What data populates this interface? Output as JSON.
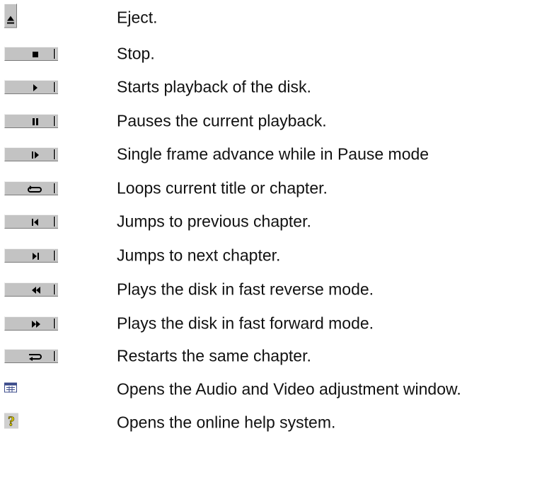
{
  "items": [
    {
      "icon": "eject-icon",
      "label": "Eject."
    },
    {
      "icon": "stop-icon",
      "label": "Stop."
    },
    {
      "icon": "play-icon",
      "label": "Starts playback of the disk."
    },
    {
      "icon": "pause-icon",
      "label": "Pauses the current playback."
    },
    {
      "icon": "step-frame-icon",
      "label": "Single frame advance while in Pause mode"
    },
    {
      "icon": "loop-icon",
      "label": "Loops current title or chapter."
    },
    {
      "icon": "previous-chapter-icon",
      "label": "Jumps to previous chapter."
    },
    {
      "icon": "next-chapter-icon",
      "label": "Jumps to next chapter."
    },
    {
      "icon": "fast-reverse-icon",
      "label": "Plays the disk in fast reverse mode."
    },
    {
      "icon": "fast-forward-icon",
      "label": "Plays the disk in fast forward mode."
    },
    {
      "icon": "restart-chapter-icon",
      "label": "Restarts the same chapter."
    },
    {
      "icon": "av-adjustment-icon",
      "label": "Opens the Audio and Video adjustment window."
    },
    {
      "icon": "help-icon",
      "label": "Opens the online help system."
    }
  ]
}
